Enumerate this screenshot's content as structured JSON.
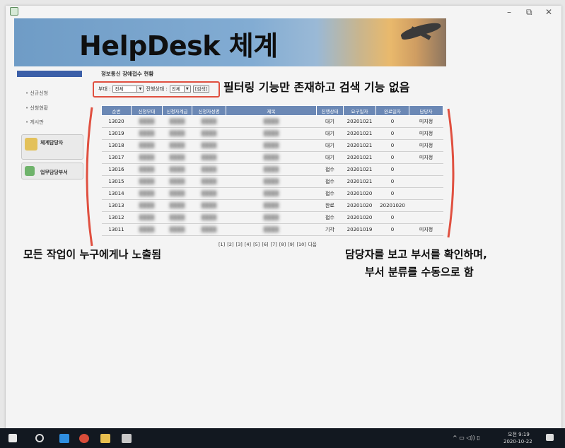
{
  "banner": {
    "title": "HelpDesk 체계"
  },
  "window": {
    "min": "–",
    "max": "⧉",
    "close": "✕"
  },
  "sidebar": {
    "items": [
      {
        "label": "신규신청"
      },
      {
        "label": "신청현황"
      },
      {
        "label": "게시판"
      }
    ],
    "boxes": [
      {
        "label": "체계담당자"
      },
      {
        "label": "업무담당부서"
      }
    ]
  },
  "page": {
    "title": "정보통신 장애접수 현황"
  },
  "filter": {
    "dept_label": "부대 :",
    "dept_value": "전체",
    "status_label": "진행상태 :",
    "status_value": "전체",
    "search_button": "[검색]"
  },
  "table": {
    "headers": [
      "순번",
      "신청부대",
      "신청자계급",
      "신청자성명",
      "제목",
      "진행상태",
      "요구일자",
      "완료일자",
      "담당자"
    ],
    "rows": [
      {
        "id": "13020",
        "status": "대기",
        "req": "20201021",
        "done": "0",
        "owner": "미지정"
      },
      {
        "id": "13019",
        "status": "대기",
        "req": "20201021",
        "done": "0",
        "owner": "미지정"
      },
      {
        "id": "13018",
        "status": "대기",
        "req": "20201021",
        "done": "0",
        "owner": "미지정"
      },
      {
        "id": "13017",
        "status": "대기",
        "req": "20201021",
        "done": "0",
        "owner": "미지정"
      },
      {
        "id": "13016",
        "status": "접수",
        "req": "20201021",
        "done": "0",
        "owner": ""
      },
      {
        "id": "13015",
        "status": "접수",
        "req": "20201021",
        "done": "0",
        "owner": ""
      },
      {
        "id": "13014",
        "status": "접수",
        "req": "20201020",
        "done": "0",
        "owner": ""
      },
      {
        "id": "13013",
        "status": "완료",
        "req": "20201020",
        "done": "20201020",
        "owner": ""
      },
      {
        "id": "13012",
        "status": "접수",
        "req": "20201020",
        "done": "0",
        "owner": ""
      },
      {
        "id": "13011",
        "status": "기각",
        "req": "20201019",
        "done": "0",
        "owner": "미지정"
      }
    ]
  },
  "pager": {
    "text": "[1] [2] [3] [4] [5] [6] [7] [8] [9] [10]  다음"
  },
  "annotations": {
    "filter_note": "필터링 기능만 존재하고 검색 기능 없음",
    "exposure_note": "모든 작업이 누구에게나 노출됨",
    "manual_note_1": "담당자를 보고 부서를 확인하며,",
    "manual_note_2": "부서 분류를 수동으로 함"
  },
  "taskbar": {
    "time": "오전 9:19",
    "date": "2020-10-22"
  },
  "colors": {
    "accent": "#6b88b5",
    "annotation_red": "#e05040",
    "sidebar_blue": "#3c5fa8"
  }
}
